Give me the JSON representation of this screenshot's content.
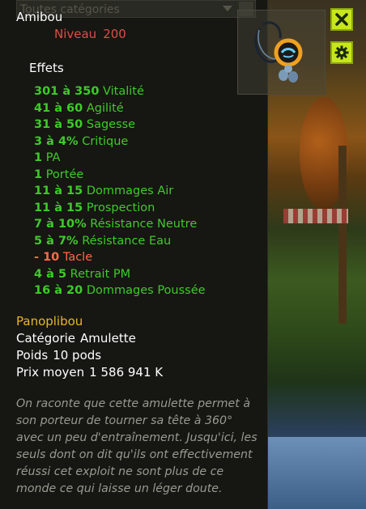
{
  "dropdown": {
    "label": "Toutes catégories"
  },
  "item": {
    "name": "Amibou",
    "level_label": "Niveau",
    "level_value": "200",
    "effects_title": "Effets",
    "effects": [
      {
        "range": "301 à 350",
        "stat": "Vitalité",
        "negative": false
      },
      {
        "range": "41 à 60",
        "stat": "Agilité",
        "negative": false
      },
      {
        "range": "31 à 50",
        "stat": "Sagesse",
        "negative": false
      },
      {
        "range": "3 à 4%",
        "stat": "Critique",
        "negative": false
      },
      {
        "range": "1",
        "stat": "PA",
        "negative": false
      },
      {
        "range": "1",
        "stat": "Portée",
        "negative": false
      },
      {
        "range": "11 à 15",
        "stat": "Dommages Air",
        "negative": false
      },
      {
        "range": "11 à 15",
        "stat": "Prospection",
        "negative": false
      },
      {
        "range": "7 à 10%",
        "stat": "Résistance Neutre",
        "negative": false
      },
      {
        "range": "5 à 7%",
        "stat": "Résistance Eau",
        "negative": false
      },
      {
        "range": "- 10",
        "stat": "Tacle",
        "negative": true
      },
      {
        "range": "4 à 5",
        "stat": "Retrait PM",
        "negative": false
      },
      {
        "range": "16 à 20",
        "stat": "Dommages Poussée",
        "negative": false
      }
    ],
    "set_name": "Panoplibou",
    "category_label": "Catégorie",
    "category_value": "Amulette",
    "weight_label": "Poids",
    "weight_value": "10 pods",
    "price_label": "Prix moyen",
    "price_value": "1 586 941 K",
    "description": "On raconte que cette amulette permet à son porteur de tourner sa tête à 360° avec un peu d'entraînement. Jusqu'ici, les seuls dont on dit qu'ils ont effectivement réussi cet exploit ne sont plus de ce monde ce qui laisse un léger doute."
  },
  "buttons": {
    "close_icon": "close-icon",
    "settings_icon": "gear-icon"
  },
  "colors": {
    "bonus": "#3ecb2a",
    "malus": "#ff6a4a",
    "level": "#d9504a",
    "set": "#e8b628",
    "button": "#c8e61c"
  }
}
